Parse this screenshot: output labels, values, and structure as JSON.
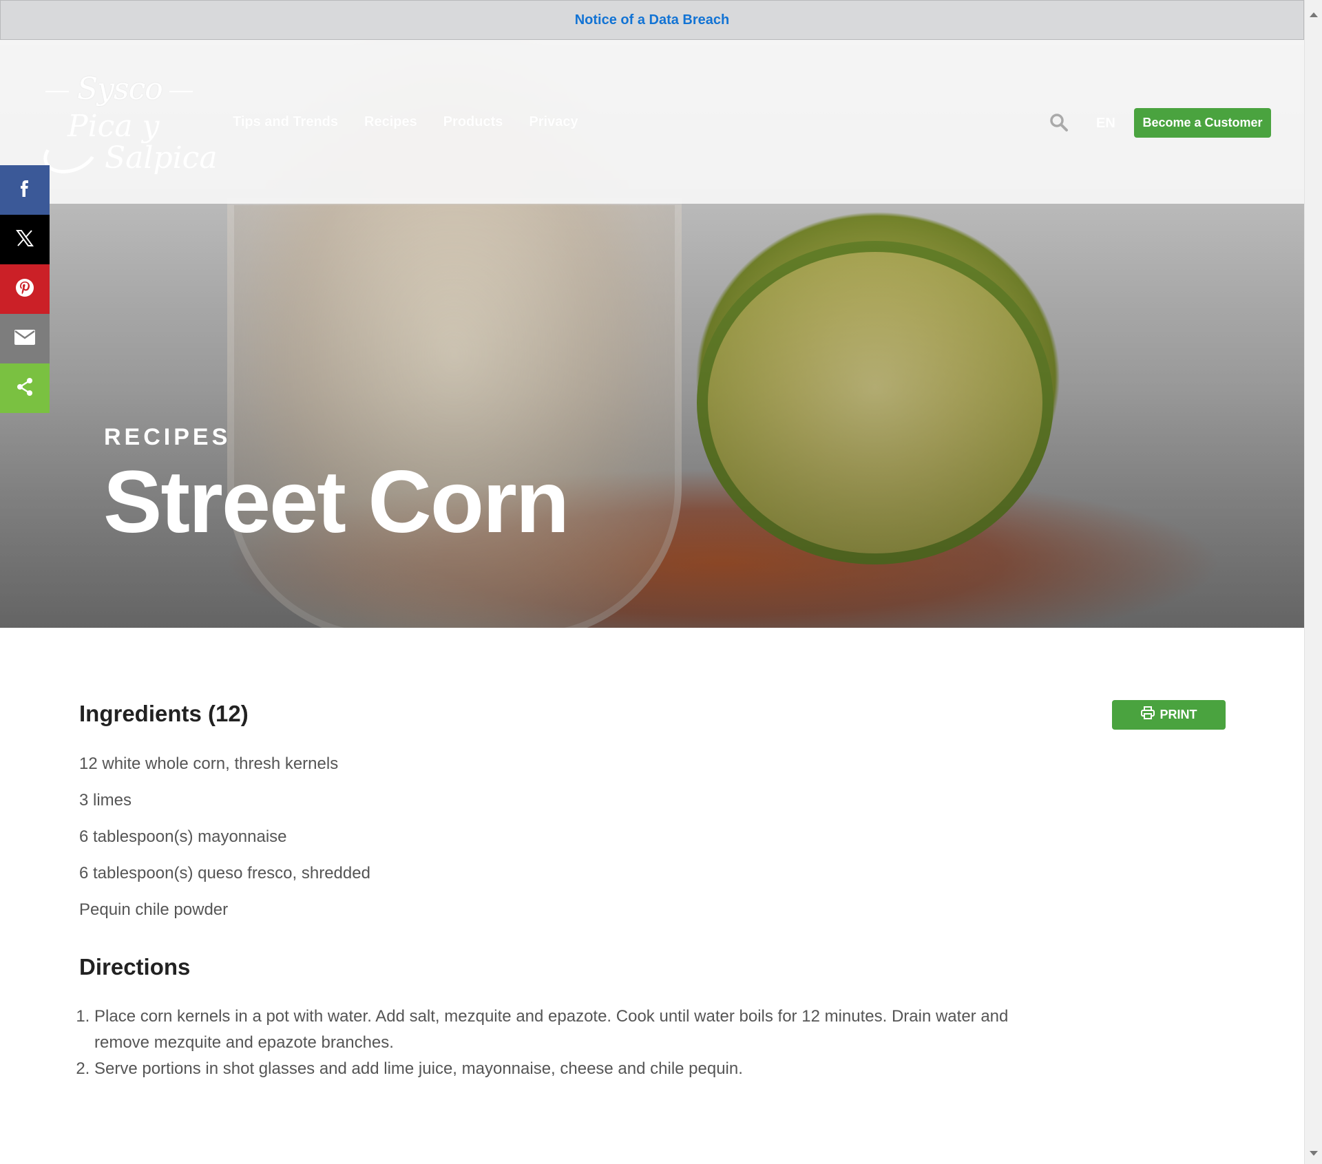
{
  "notice": {
    "text": "Notice of a Data Breach"
  },
  "header": {
    "logo": {
      "brand": "Sysco",
      "line1": "Pica y",
      "line2": "Salpica"
    },
    "nav": [
      "Tips and Trends",
      "Recipes",
      "Products",
      "Privacy"
    ],
    "language": "EN",
    "cta_label": "Become a Customer"
  },
  "share": {
    "icons": [
      "facebook-icon",
      "x-icon",
      "pinterest-icon",
      "email-icon",
      "share-icon"
    ],
    "colors": {
      "facebook": "#3b5998",
      "x": "#000000",
      "pinterest": "#cb2027",
      "email": "#7d7d7d",
      "share": "#7ac141"
    }
  },
  "hero": {
    "eyebrow": "RECIPES",
    "title": "Street Corn"
  },
  "recipe": {
    "ingredients_heading": "Ingredients (12)",
    "print_label": "PRINT",
    "ingredients": [
      "12 white whole corn, thresh kernels",
      "3 limes",
      "6 tablespoon(s) mayonnaise",
      "6 tablespoon(s) queso fresco, shredded",
      "Pequin chile powder"
    ],
    "directions_heading": "Directions",
    "directions": [
      "Place corn kernels in a pot with water. Add salt, mezquite and epazote. Cook until water boils for 12 minutes. Drain water and remove mezquite and epazote branches.",
      "Serve portions in shot glasses and add lime juice, mayonnaise, cheese and chile pequin."
    ]
  },
  "colors": {
    "accent": "#4aa33f",
    "link": "#1273d4"
  }
}
